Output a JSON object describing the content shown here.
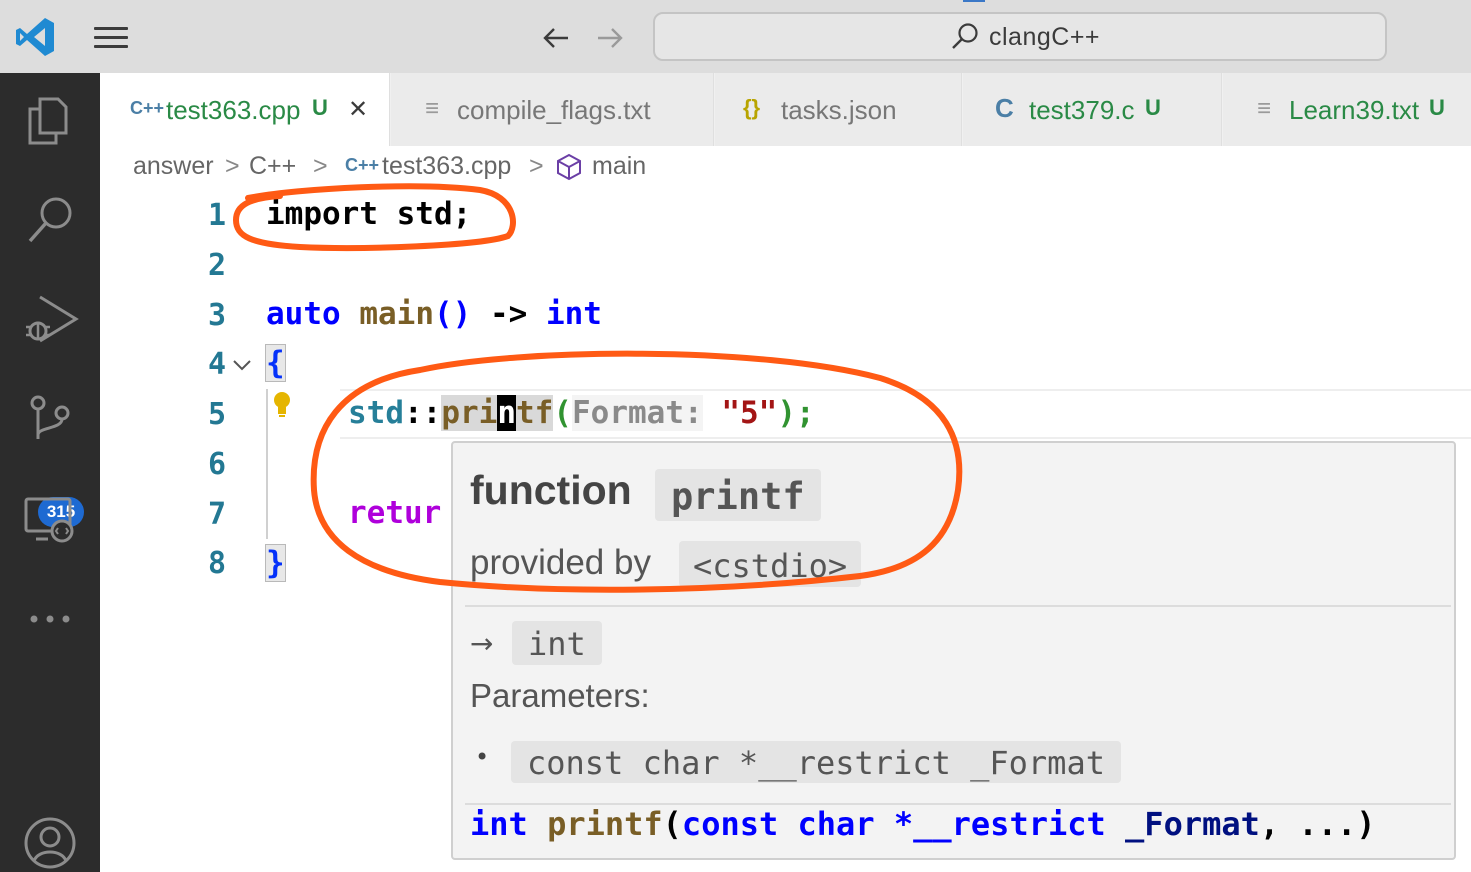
{
  "titlebar": {
    "search_label": "clangC++"
  },
  "activitybar": {
    "items": [
      "files-icon",
      "search-icon",
      "run-debug-icon",
      "source-control-icon",
      "remote-explorer-icon",
      "more-icon",
      "account-icon"
    ],
    "scm_badge": "315"
  },
  "tabs": [
    {
      "icon": "C++",
      "label": "test363.cpp",
      "status": "U",
      "close": "✕",
      "active": true
    },
    {
      "icon": "≡",
      "label": "compile_flags.txt",
      "status": ""
    },
    {
      "icon": "{}",
      "label": "tasks.json",
      "status": ""
    },
    {
      "icon": "C",
      "label": "test379.c",
      "status": "U"
    },
    {
      "icon": "≡",
      "label": "Learn39.txt",
      "status": "U"
    }
  ],
  "breadcrumb": {
    "parts": [
      "answer",
      "C++",
      "test363.cpp",
      "main"
    ],
    "separator": ">"
  },
  "editor": {
    "line_numbers": [
      "1",
      "2",
      "3",
      "4",
      "5",
      "6",
      "7",
      "8"
    ],
    "line1": {
      "kw": "import",
      "rest": " std;"
    },
    "line3": {
      "kw": "auto",
      "fn": "main",
      "paren": "()",
      "arrow": " -> ",
      "ret": "int"
    },
    "line4": "{",
    "line5": {
      "ns": "std",
      "sep": "::",
      "fn_a": "pri",
      "fn_cursor": "n",
      "fn_b": "tf",
      "open": "(",
      "hint": "Format:",
      "str": "\"5\"",
      "close": ");"
    },
    "line7": "retur",
    "line8": "}"
  },
  "hover": {
    "kind": "function",
    "name": "printf",
    "provided_by_label": "provided by",
    "provided_by": "<cstdio>",
    "returns_arrow": "→",
    "returns": "int",
    "params_label": "Parameters:",
    "param_bullet": "•",
    "param": "const char *__restrict _Format",
    "signature": {
      "ret": "int",
      "fn": "printf",
      "open": "(",
      "const": "const",
      "char": "char",
      "ptr": "*__restrict",
      "arg": "_Format",
      "rest": ", ...)"
    }
  },
  "colors": {
    "annotation": "#ff5a14",
    "keyword": "#0000ff",
    "function": "#795e26",
    "string": "#a31515",
    "control": "#af00db",
    "namespace": "#267f99",
    "line_number": "#237893",
    "untracked": "#2a8a46"
  }
}
